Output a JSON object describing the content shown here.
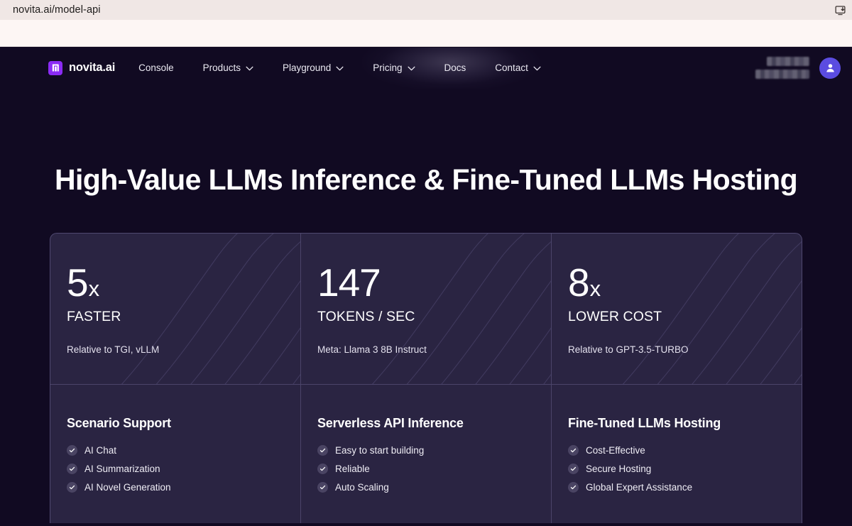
{
  "browser": {
    "tab_url": "novita.ai/model-api",
    "install_icon": "install-app-icon"
  },
  "nav": {
    "brand": "novita.ai",
    "brand_icon": "novita-door-logo-icon",
    "items": [
      {
        "label": "Console",
        "has_chevron": false
      },
      {
        "label": "Products",
        "has_chevron": true
      },
      {
        "label": "Playground",
        "has_chevron": true
      },
      {
        "label": "Pricing",
        "has_chevron": true
      },
      {
        "label": "Docs",
        "has_chevron": false
      },
      {
        "label": "Contact",
        "has_chevron": true
      }
    ],
    "account_redacted": [
      "",
      ""
    ],
    "avatar_icon": "user-avatar-icon"
  },
  "hero": {
    "title": "High-Value LLMs Inference & Fine-Tuned LLMs Hosting"
  },
  "stats": [
    {
      "value": "5",
      "suffix": "x",
      "label": "FASTER",
      "note": "Relative to TGI, vLLM"
    },
    {
      "value": "147",
      "suffix": "",
      "label": "TOKENS / SEC",
      "note": "Meta: Llama 3 8B Instruct"
    },
    {
      "value": "8",
      "suffix": "x",
      "label": "LOWER COST",
      "note": "Relative to GPT-3.5-TURBO"
    }
  ],
  "features": [
    {
      "title": "Scenario Support",
      "items": [
        "AI Chat",
        "AI Summarization",
        "AI Novel Generation"
      ]
    },
    {
      "title": "Serverless API Inference",
      "items": [
        "Easy to start building",
        "Reliable",
        "Auto Scaling"
      ]
    },
    {
      "title": "Fine-Tuned LLMs Hosting",
      "items": [
        "Cost-Effective",
        "Secure Hosting",
        "Global Expert Assistance"
      ]
    }
  ],
  "colors": {
    "page_background": "#110a22",
    "card_background": "#2a2442",
    "brand_purple": "#8b2bf5",
    "avatar_purple": "#5b4ce0",
    "tabstrip": "#f0e7e5",
    "toolbar": "#fdf6f4"
  }
}
